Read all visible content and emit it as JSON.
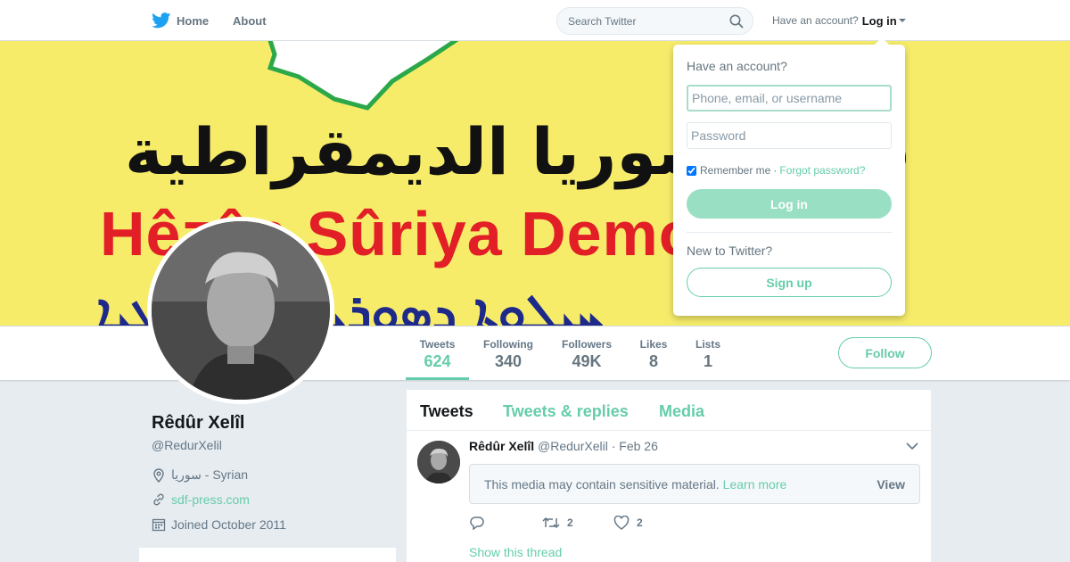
{
  "nav": {
    "home_label": "Home",
    "about_label": "About",
    "search_placeholder": "Search Twitter",
    "have_account": "Have an account?",
    "login_label": "Log in"
  },
  "banner": {
    "arabic_text": "قوات سوريا الديمقراطية",
    "kurdish_text": "Hêzên Sûriya Demokratîk",
    "syriac_text": "ܚܝܠܘܬܐ ܕܣܘܪܝܐ ܕܝܡܩܪܛܝܐ",
    "colors": {
      "background": "#f6ec6a",
      "kurdish": "#e21f26",
      "syriac": "#1e2a8a",
      "map_border": "#2ba84a"
    }
  },
  "profile": {
    "name": "Rêdûr Xelîl",
    "handle": "@RedurXelil",
    "location": "سوريا - Syrian",
    "website": "sdf-press.com",
    "joined": "Joined October 2011",
    "follow_label": "Follow"
  },
  "stats": [
    {
      "label": "Tweets",
      "value": "624"
    },
    {
      "label": "Following",
      "value": "340"
    },
    {
      "label": "Followers",
      "value": "49K"
    },
    {
      "label": "Likes",
      "value": "8"
    },
    {
      "label": "Lists",
      "value": "1"
    }
  ],
  "timeline": {
    "tabs": [
      "Tweets",
      "Tweets & replies",
      "Media"
    ],
    "tweet": {
      "author": "Rêdûr Xelîl",
      "handle": "@RedurXelil",
      "date": "· Feb 26",
      "sensitive_msg": "This media may contain sensitive material.",
      "learn_more": "Learn more",
      "view_label": "View",
      "retweets": "2",
      "likes": "2",
      "show_thread": "Show this thread"
    }
  },
  "login_dropdown": {
    "title": "Have an account?",
    "username_placeholder": "Phone, email, or username",
    "password_placeholder": "Password",
    "remember_label": "Remember me",
    "separator": "·",
    "forgot_label": "Forgot password?",
    "login_button": "Log in",
    "new_label": "New to Twitter?",
    "signup_button": "Sign up"
  },
  "colors": {
    "accent": "#66cdaa",
    "twitter_blue": "#1da1f2"
  }
}
